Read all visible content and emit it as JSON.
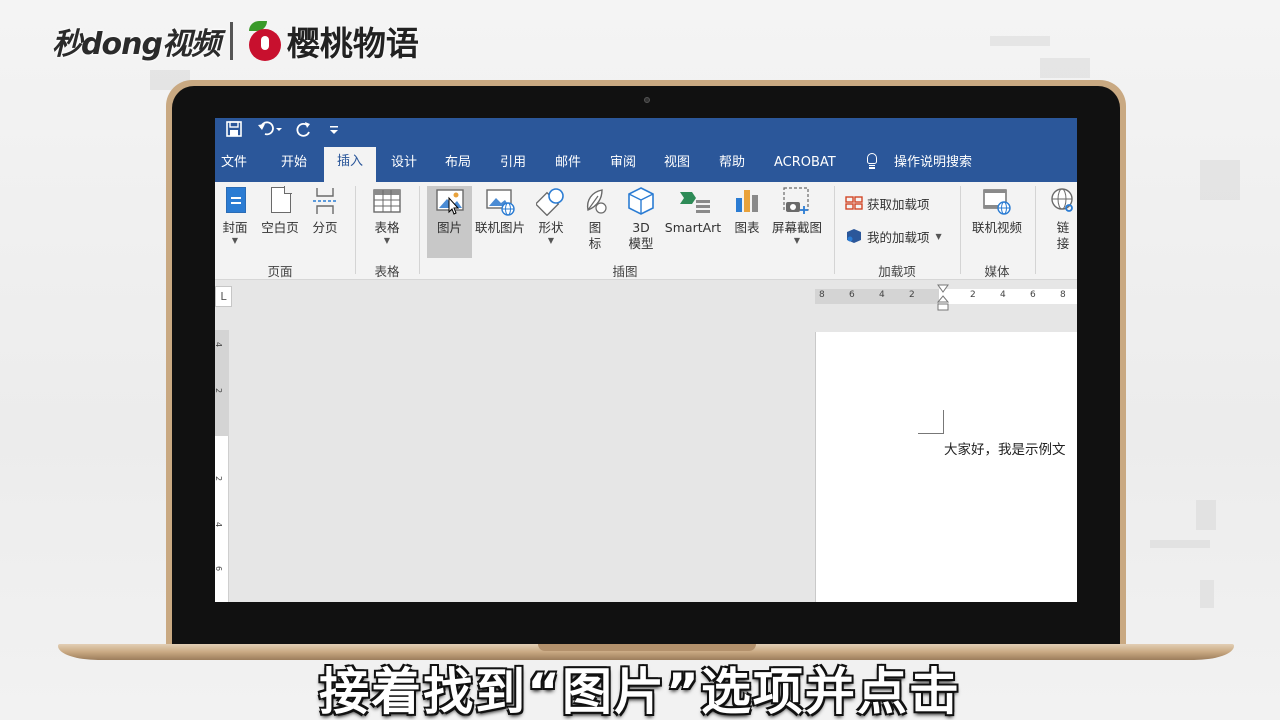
{
  "branding": {
    "miaodong": "秒dong视频",
    "cherry": "樱桃物语"
  },
  "qat": {
    "save_icon": "save-icon",
    "undo_icon": "undo-icon",
    "redo_icon": "redo-icon",
    "customize_icon": "customize-qat-icon"
  },
  "tabs": [
    {
      "label": "文件"
    },
    {
      "label": "开始"
    },
    {
      "label": "插入",
      "active": true
    },
    {
      "label": "设计"
    },
    {
      "label": "布局"
    },
    {
      "label": "引用"
    },
    {
      "label": "邮件"
    },
    {
      "label": "审阅"
    },
    {
      "label": "视图"
    },
    {
      "label": "帮助"
    },
    {
      "label": "ACROBAT"
    }
  ],
  "tell_me": "操作说明搜索",
  "ribbon": {
    "pages": {
      "cover": "封面",
      "blank": "空白页",
      "break": "分页",
      "label": "页面"
    },
    "tables": {
      "table": "表格",
      "label": "表格"
    },
    "illustrations": {
      "picture": "图片",
      "online_picture": "联机图片",
      "shapes": "形状",
      "icons_1": "图",
      "icons_2": "标",
      "model_1": "3D",
      "model_2": "模型",
      "smartart": "SmartArt",
      "chart": "图表",
      "screenshot": "屏幕截图",
      "label": "插图"
    },
    "addins": {
      "get": "获取加载项",
      "mine": "我的加载项",
      "label": "加载项"
    },
    "media": {
      "online_video": "联机视频",
      "label": "媒体"
    },
    "links": {
      "link_1": "链",
      "link_2": "接"
    }
  },
  "ruler": {
    "corner": "L",
    "h_ticks": [
      "8",
      "6",
      "4",
      "2",
      "2",
      "4",
      "6",
      "8"
    ],
    "v_ticks": [
      "4",
      "2",
      "2",
      "4",
      "6"
    ]
  },
  "document": {
    "text": "大家好，我是示例文"
  },
  "caption": "接着找到“图片”选项并点击"
}
